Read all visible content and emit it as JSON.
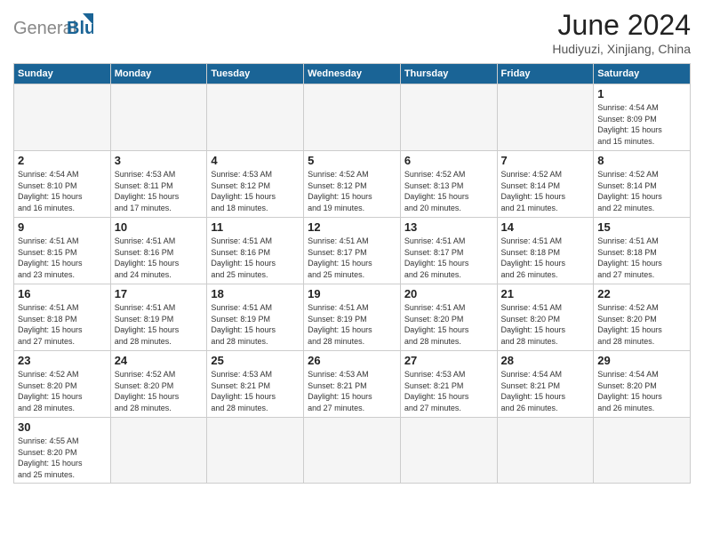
{
  "logo": {
    "text_general": "General",
    "text_blue": "Blue"
  },
  "header": {
    "title": "June 2024",
    "subtitle": "Hudiyuzi, Xinjiang, China"
  },
  "weekdays": [
    "Sunday",
    "Monday",
    "Tuesday",
    "Wednesday",
    "Thursday",
    "Friday",
    "Saturday"
  ],
  "weeks": [
    [
      {
        "day": "",
        "empty": true
      },
      {
        "day": "",
        "empty": true
      },
      {
        "day": "",
        "empty": true
      },
      {
        "day": "",
        "empty": true
      },
      {
        "day": "",
        "empty": true
      },
      {
        "day": "",
        "empty": true
      },
      {
        "day": "1",
        "info": "Sunrise: 4:54 AM\nSunset: 8:09 PM\nDaylight: 15 hours\nand 15 minutes."
      }
    ],
    [
      {
        "day": "2",
        "info": "Sunrise: 4:54 AM\nSunset: 8:10 PM\nDaylight: 15 hours\nand 16 minutes."
      },
      {
        "day": "3",
        "info": "Sunrise: 4:53 AM\nSunset: 8:11 PM\nDaylight: 15 hours\nand 17 minutes."
      },
      {
        "day": "4",
        "info": "Sunrise: 4:53 AM\nSunset: 8:12 PM\nDaylight: 15 hours\nand 18 minutes."
      },
      {
        "day": "5",
        "info": "Sunrise: 4:52 AM\nSunset: 8:12 PM\nDaylight: 15 hours\nand 19 minutes."
      },
      {
        "day": "6",
        "info": "Sunrise: 4:52 AM\nSunset: 8:13 PM\nDaylight: 15 hours\nand 20 minutes."
      },
      {
        "day": "7",
        "info": "Sunrise: 4:52 AM\nSunset: 8:14 PM\nDaylight: 15 hours\nand 21 minutes."
      },
      {
        "day": "8",
        "info": "Sunrise: 4:52 AM\nSunset: 8:14 PM\nDaylight: 15 hours\nand 22 minutes."
      }
    ],
    [
      {
        "day": "9",
        "info": "Sunrise: 4:51 AM\nSunset: 8:15 PM\nDaylight: 15 hours\nand 23 minutes."
      },
      {
        "day": "10",
        "info": "Sunrise: 4:51 AM\nSunset: 8:16 PM\nDaylight: 15 hours\nand 24 minutes."
      },
      {
        "day": "11",
        "info": "Sunrise: 4:51 AM\nSunset: 8:16 PM\nDaylight: 15 hours\nand 25 minutes."
      },
      {
        "day": "12",
        "info": "Sunrise: 4:51 AM\nSunset: 8:17 PM\nDaylight: 15 hours\nand 25 minutes."
      },
      {
        "day": "13",
        "info": "Sunrise: 4:51 AM\nSunset: 8:17 PM\nDaylight: 15 hours\nand 26 minutes."
      },
      {
        "day": "14",
        "info": "Sunrise: 4:51 AM\nSunset: 8:18 PM\nDaylight: 15 hours\nand 26 minutes."
      },
      {
        "day": "15",
        "info": "Sunrise: 4:51 AM\nSunset: 8:18 PM\nDaylight: 15 hours\nand 27 minutes."
      }
    ],
    [
      {
        "day": "16",
        "info": "Sunrise: 4:51 AM\nSunset: 8:18 PM\nDaylight: 15 hours\nand 27 minutes."
      },
      {
        "day": "17",
        "info": "Sunrise: 4:51 AM\nSunset: 8:19 PM\nDaylight: 15 hours\nand 28 minutes."
      },
      {
        "day": "18",
        "info": "Sunrise: 4:51 AM\nSunset: 8:19 PM\nDaylight: 15 hours\nand 28 minutes."
      },
      {
        "day": "19",
        "info": "Sunrise: 4:51 AM\nSunset: 8:19 PM\nDaylight: 15 hours\nand 28 minutes."
      },
      {
        "day": "20",
        "info": "Sunrise: 4:51 AM\nSunset: 8:20 PM\nDaylight: 15 hours\nand 28 minutes."
      },
      {
        "day": "21",
        "info": "Sunrise: 4:51 AM\nSunset: 8:20 PM\nDaylight: 15 hours\nand 28 minutes."
      },
      {
        "day": "22",
        "info": "Sunrise: 4:52 AM\nSunset: 8:20 PM\nDaylight: 15 hours\nand 28 minutes."
      }
    ],
    [
      {
        "day": "23",
        "info": "Sunrise: 4:52 AM\nSunset: 8:20 PM\nDaylight: 15 hours\nand 28 minutes."
      },
      {
        "day": "24",
        "info": "Sunrise: 4:52 AM\nSunset: 8:20 PM\nDaylight: 15 hours\nand 28 minutes."
      },
      {
        "day": "25",
        "info": "Sunrise: 4:53 AM\nSunset: 8:21 PM\nDaylight: 15 hours\nand 28 minutes."
      },
      {
        "day": "26",
        "info": "Sunrise: 4:53 AM\nSunset: 8:21 PM\nDaylight: 15 hours\nand 27 minutes."
      },
      {
        "day": "27",
        "info": "Sunrise: 4:53 AM\nSunset: 8:21 PM\nDaylight: 15 hours\nand 27 minutes."
      },
      {
        "day": "28",
        "info": "Sunrise: 4:54 AM\nSunset: 8:21 PM\nDaylight: 15 hours\nand 26 minutes."
      },
      {
        "day": "29",
        "info": "Sunrise: 4:54 AM\nSunset: 8:20 PM\nDaylight: 15 hours\nand 26 minutes."
      }
    ],
    [
      {
        "day": "30",
        "info": "Sunrise: 4:55 AM\nSunset: 8:20 PM\nDaylight: 15 hours\nand 25 minutes."
      },
      {
        "day": "",
        "empty": true
      },
      {
        "day": "",
        "empty": true
      },
      {
        "day": "",
        "empty": true
      },
      {
        "day": "",
        "empty": true
      },
      {
        "day": "",
        "empty": true
      },
      {
        "day": "",
        "empty": true
      }
    ]
  ]
}
